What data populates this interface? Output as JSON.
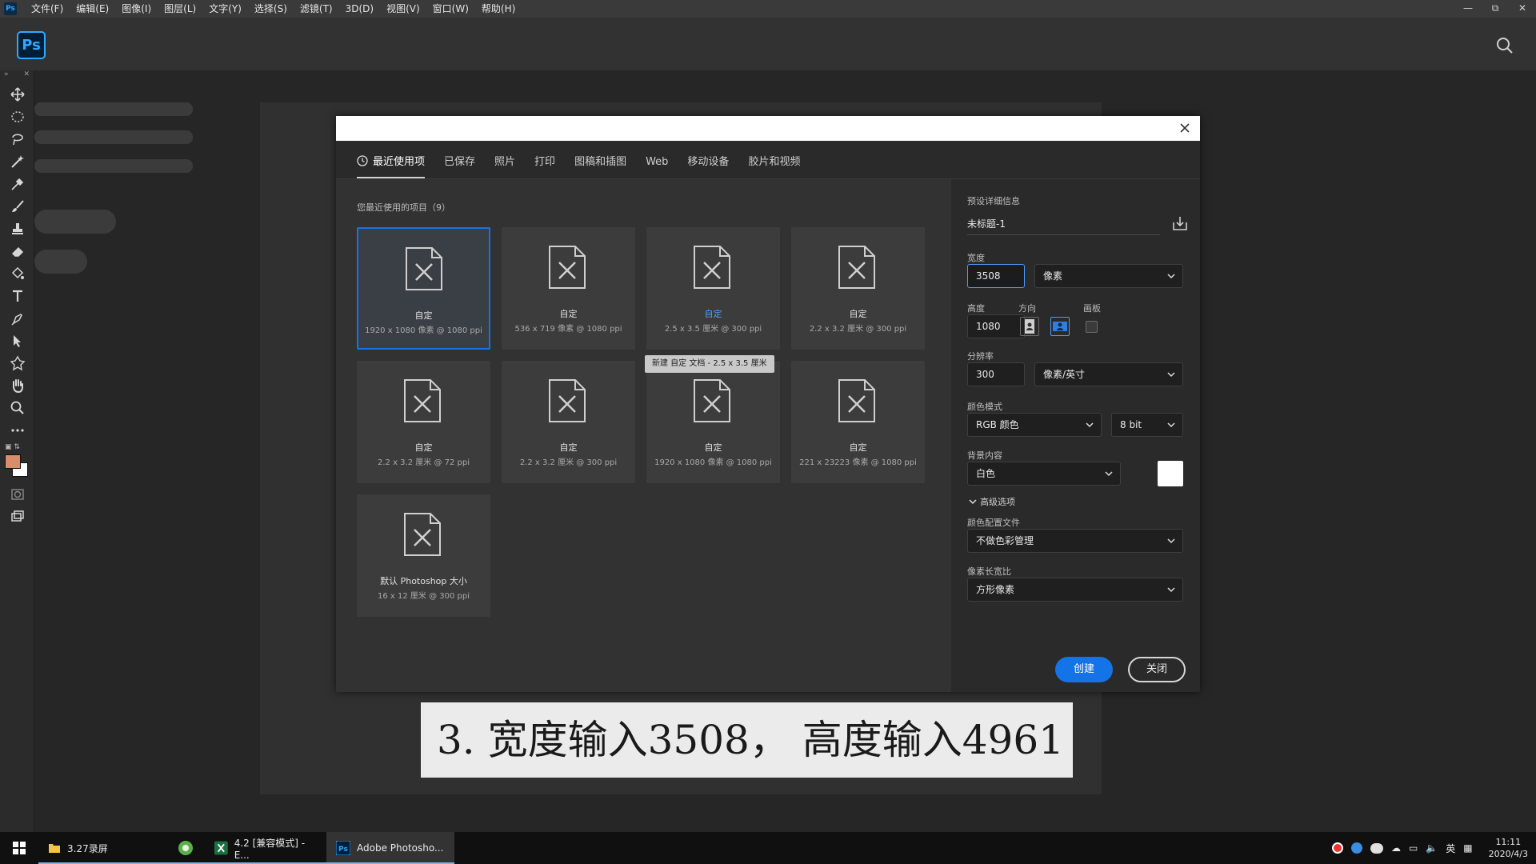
{
  "menubar": {
    "app_icon": "Ps",
    "items": [
      "文件(F)",
      "编辑(E)",
      "图像(I)",
      "图层(L)",
      "文字(Y)",
      "选择(S)",
      "滤镜(T)",
      "3D(D)",
      "视图(V)",
      "窗口(W)",
      "帮助(H)"
    ],
    "window_controls": [
      "minimize-icon",
      "restore-icon",
      "close-icon"
    ]
  },
  "header": {
    "logo": "Ps",
    "search_icon": "search-icon"
  },
  "toolbar": {
    "tools": [
      "move-icon",
      "marquee-icon",
      "lasso-icon",
      "magic-wand-icon",
      "eyedropper-icon",
      "brush-icon",
      "stamp-icon",
      "eraser-icon",
      "paint-bucket-icon",
      "text-icon",
      "pen-icon",
      "path-select-icon",
      "shape-icon",
      "hand-icon",
      "zoom-icon",
      "more-icon",
      "quick-mask-icon",
      "screen-mode-icon"
    ],
    "fg_color": "#d98d6a",
    "bg_color": "#ffffff"
  },
  "dialog": {
    "tabs": [
      {
        "label": "最近使用项",
        "active": true
      },
      {
        "label": "已保存"
      },
      {
        "label": "照片"
      },
      {
        "label": "打印"
      },
      {
        "label": "图稿和插图"
      },
      {
        "label": "Web"
      },
      {
        "label": "移动设备"
      },
      {
        "label": "胶片和视频"
      }
    ],
    "recent_label": "您最近使用的项目（9）",
    "presets": [
      {
        "name": "自定",
        "size": "1920 x 1080 像素 @ 1080 ppi",
        "selected": true
      },
      {
        "name": "自定",
        "size": "536 x 719 像素 @ 1080 ppi"
      },
      {
        "name": "自定",
        "size": "2.5 x 3.5 厘米 @ 300 ppi",
        "highlight": true
      },
      {
        "name": "自定",
        "size": "2.2 x 3.2 厘米 @ 300 ppi"
      },
      {
        "name": "自定",
        "size": "2.2 x 3.2 厘米 @ 72 ppi"
      },
      {
        "name": "自定",
        "size": "2.2 x 3.2 厘米 @ 300 ppi"
      },
      {
        "name": "自定",
        "size": "1920 x 1080 像素 @ 1080 ppi"
      },
      {
        "name": "自定",
        "size": "221 x 23223 像素 @ 1080 ppi"
      },
      {
        "name": "默认 Photoshop 大小",
        "size": "16 x 12 厘米 @ 300 ppi"
      }
    ],
    "tooltip": "新建 自定 文档 - 2.5 x 3.5 厘米",
    "details": {
      "section_title": "预设详细信息",
      "doc_title": "未标题-1",
      "width_label": "宽度",
      "width_value": "3508",
      "width_unit": "像素",
      "height_label": "高度",
      "height_value": "1080",
      "orientation_label": "方向",
      "artboard_label": "画板",
      "resolution_label": "分辨率",
      "resolution_value": "300",
      "resolution_unit": "像素/英寸",
      "color_mode_label": "颜色模式",
      "color_mode": "RGB 颜色",
      "bit_depth": "8 bit",
      "bg_content_label": "背景内容",
      "bg_content": "白色",
      "bg_color": "#ffffff",
      "advanced_label": "高级选项",
      "color_profile_label": "颜色配置文件",
      "color_profile": "不做色彩管理",
      "pixel_aspect_label": "像素长宽比",
      "pixel_aspect": "方形像素"
    },
    "create_label": "创建",
    "close_label": "关闭"
  },
  "caption": "3. 宽度输入3508， 高度输入4961",
  "taskbar": {
    "items": [
      {
        "label": "3.27录屏",
        "icon": "folder-icon"
      },
      {
        "label": "",
        "icon": "browser-icon"
      },
      {
        "label": "4.2 [兼容模式] - E...",
        "icon": "excel-icon"
      },
      {
        "label": "Adobe Photosho...",
        "icon": "photoshop-icon",
        "active": true
      }
    ],
    "ime": "英",
    "time": "11:11",
    "date": "2020/4/3"
  }
}
